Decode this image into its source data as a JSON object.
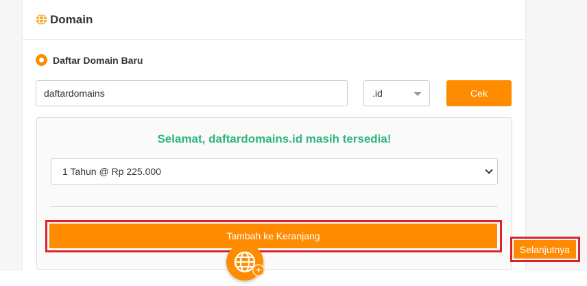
{
  "section": {
    "title": "Domain",
    "icon": "globe-icon"
  },
  "register": {
    "option_label": "Daftar Domain Baru",
    "selected": true
  },
  "search": {
    "domain_value": "daftardomains",
    "tld_value": ".id",
    "check_label": "Cek"
  },
  "result": {
    "message": "Selamat, daftardomains.id masih tersedia!",
    "period_value": "1 Tahun @ Rp 225.000",
    "add_to_cart_label": "Tambah ke Keranjang"
  },
  "footer": {
    "next_label": "Selanjutnya"
  },
  "colors": {
    "accent": "#ff8c00",
    "success": "#2eb67d",
    "highlight": "#e0202a"
  }
}
